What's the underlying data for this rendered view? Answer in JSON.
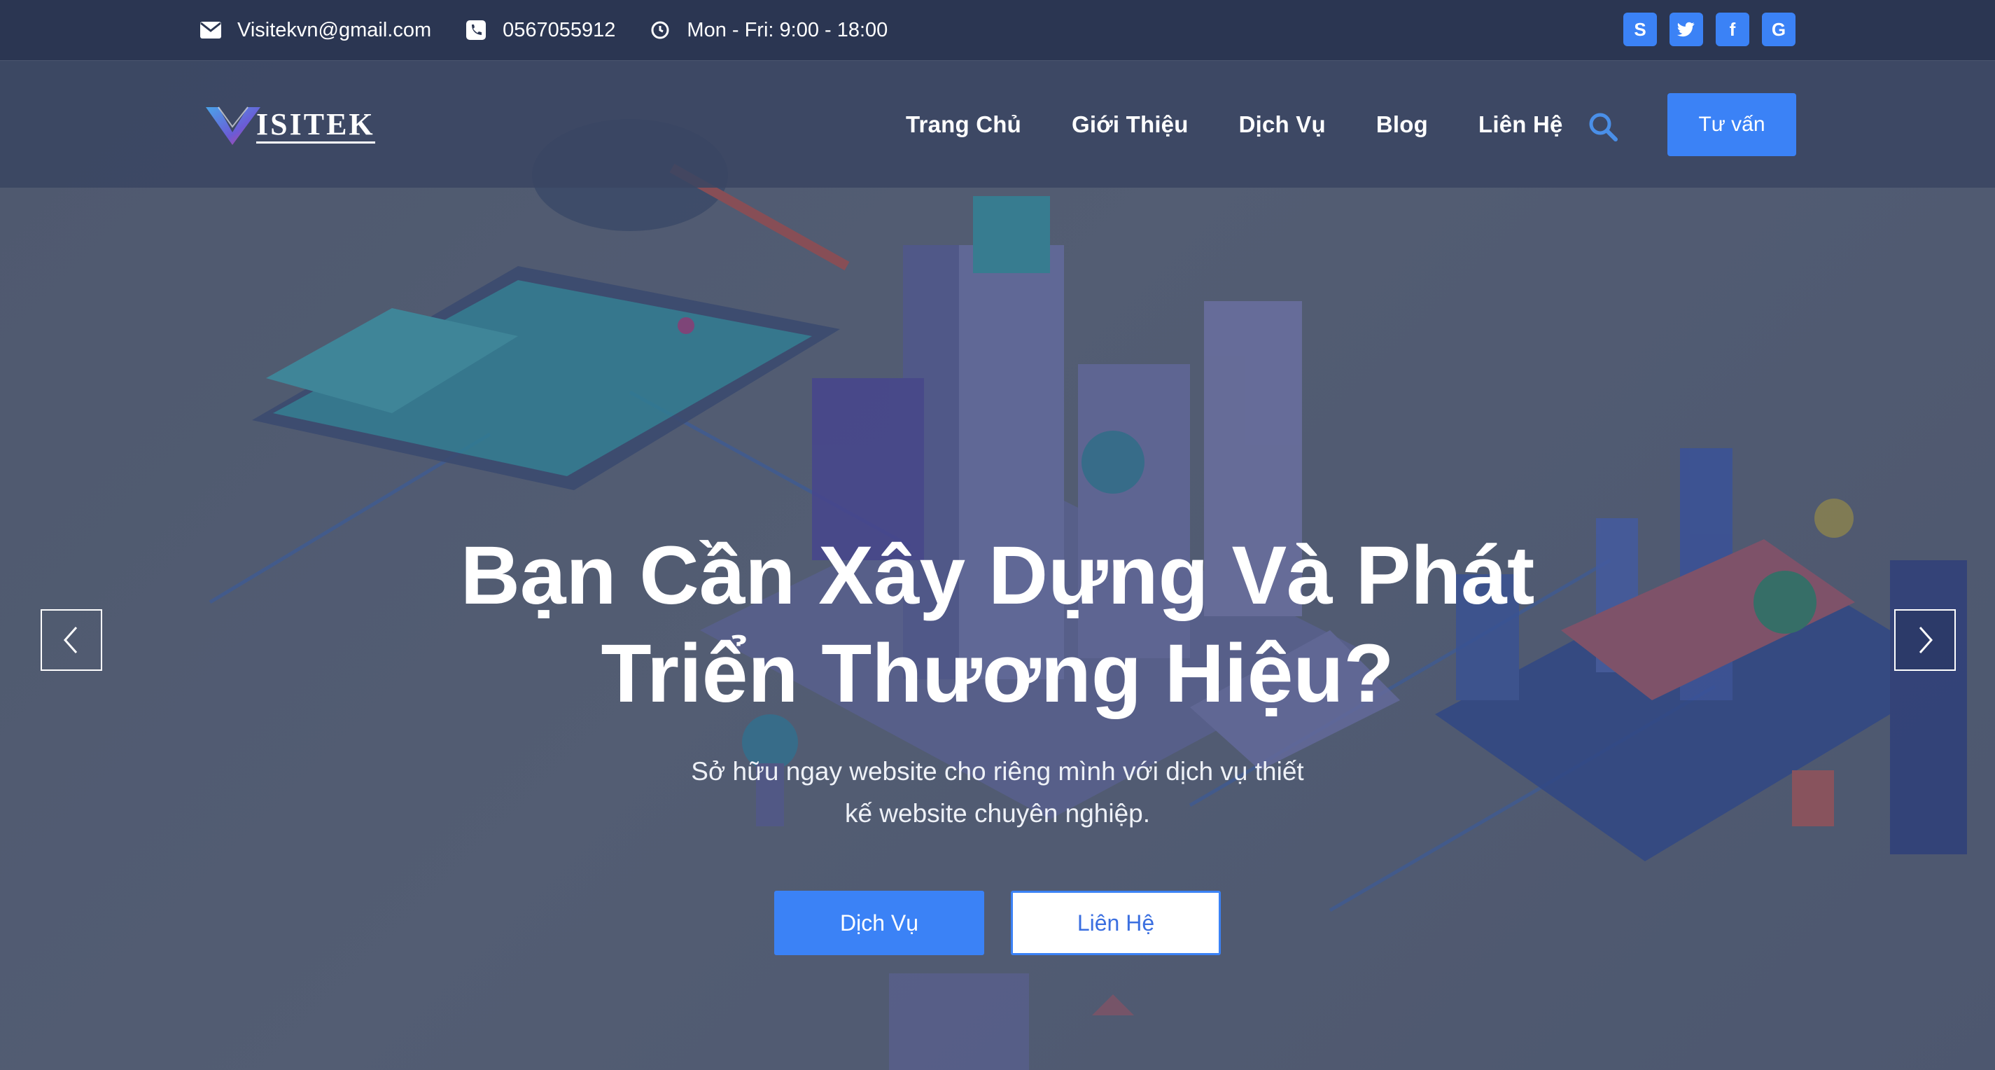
{
  "topbar": {
    "email": "Visitekvn@gmail.com",
    "phone": "0567055912",
    "hours": "Mon - Fri: 9:00 - 18:00",
    "icons": [
      "envelope-icon",
      "phone-icon",
      "clock-icon"
    ],
    "social": [
      {
        "name": "skype-icon",
        "glyph": "S"
      },
      {
        "name": "twitter-icon",
        "glyph": "t"
      },
      {
        "name": "facebook-icon",
        "glyph": "f"
      },
      {
        "name": "google-icon",
        "glyph": "G"
      }
    ]
  },
  "nav": {
    "logo_text": "ISITEK",
    "items": [
      {
        "label": "Trang Chủ"
      },
      {
        "label": "Giới Thiệu"
      },
      {
        "label": "Dịch Vụ"
      },
      {
        "label": "Blog"
      },
      {
        "label": "Liên Hệ"
      }
    ],
    "cta_label": "Tư vấn"
  },
  "hero": {
    "title_line1": "Bạn Cần Xây Dựng Và Phát",
    "title_line2": "Triển Thương Hiệu?",
    "subtitle_line1": "Sở hữu ngay website cho riêng mình với dịch vụ thiết",
    "subtitle_line2": "kế website chuyên nghiệp.",
    "primary_button": "Dịch Vụ",
    "secondary_button": "Liên Hệ"
  },
  "colors": {
    "topbar_bg": "#2b3652",
    "accent": "#3b82f6",
    "text_light": "#ffffff"
  }
}
